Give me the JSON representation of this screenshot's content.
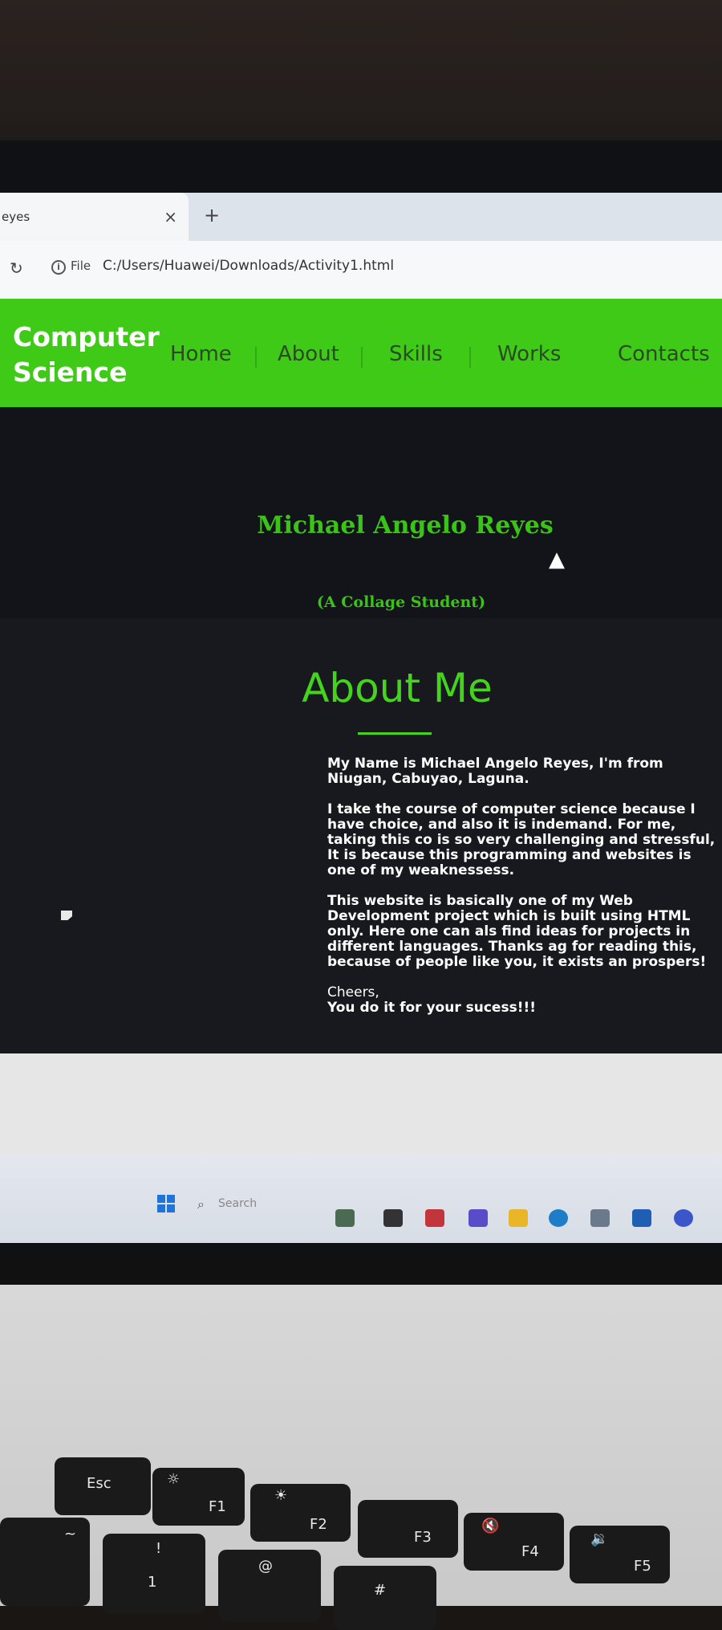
{
  "browser": {
    "tab_title": "eyes",
    "new_tab": "+",
    "close": "×",
    "file_label": "File",
    "url": "C:/Users/Huawei/Downloads/Activity1.html"
  },
  "site": {
    "brand": "Computer Science",
    "nav": [
      "Home",
      "About",
      "Skills",
      "Works",
      "Contacts"
    ],
    "hero_name": "Michael Angelo Reyes",
    "hero_subtitle": "(A Collage Student)",
    "about_title": "About Me",
    "about_paragraphs": [
      "My Name is Michael Angelo Reyes, I'm from Niugan, Cabuyao, Laguna.",
      "I take the course of computer science because I have choice, and also it is indemand. For me, taking this co is so very challenging and stressful, It is because this programming and websites is one of my weaknessess.",
      "This website is basically one of my Web Development project which is built using HTML only. Here one can als find ideas for projects in different languages. Thanks ag for reading this, because of people like you, it exists an prospers!"
    ],
    "cheers": "Cheers,",
    "closing": "You do it for your sucess!!!"
  },
  "taskbar": {
    "search_placeholder": "Search"
  },
  "keyboard": {
    "keys": [
      "Esc",
      "F1",
      "F2",
      "F3",
      "F4",
      "F5",
      "!",
      "1",
      "@",
      "#",
      "~"
    ]
  },
  "colors": {
    "accent_green": "#3fca18",
    "page_bg": "#15171c"
  }
}
